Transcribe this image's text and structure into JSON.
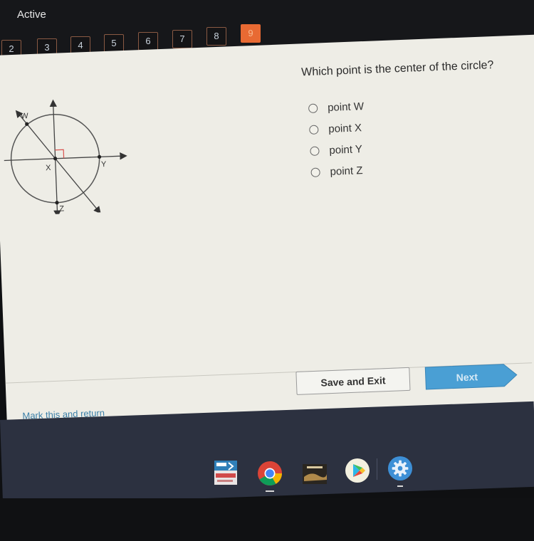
{
  "header": {
    "status_label": "Active",
    "questions": [
      {
        "label": "2",
        "active": false
      },
      {
        "label": "3",
        "active": false
      },
      {
        "label": "4",
        "active": false
      },
      {
        "label": "5",
        "active": false
      },
      {
        "label": "6",
        "active": false
      },
      {
        "label": "7",
        "active": false
      },
      {
        "label": "8",
        "active": false
      },
      {
        "label": "9",
        "active": true
      }
    ]
  },
  "question": {
    "prompt": "Which point is the center of the circle?",
    "options": [
      {
        "label": "point W",
        "selected": false
      },
      {
        "label": "point X",
        "selected": false
      },
      {
        "label": "point Y",
        "selected": false
      },
      {
        "label": "point Z",
        "selected": false
      }
    ],
    "diagram": {
      "points": [
        "W",
        "X",
        "Y",
        "Z"
      ],
      "right_angle_marker": true
    }
  },
  "footer": {
    "save_label": "Save and Exit",
    "next_label": "Next",
    "mark_label": "Mark this and return"
  },
  "shelf": {
    "apps": [
      {
        "name": "edgenuity-app",
        "icon": "app-tile-icon"
      },
      {
        "name": "chrome",
        "icon": "chrome-icon"
      },
      {
        "name": "collections-app",
        "icon": "photo-icon"
      },
      {
        "name": "play-store",
        "icon": "play-store-icon"
      },
      {
        "name": "settings",
        "icon": "gear-icon"
      }
    ]
  },
  "colors": {
    "active_question": "#e86a33",
    "next_button": "#4a9fd4",
    "link": "#3b7fa8",
    "right_angle": "#d9534f"
  }
}
